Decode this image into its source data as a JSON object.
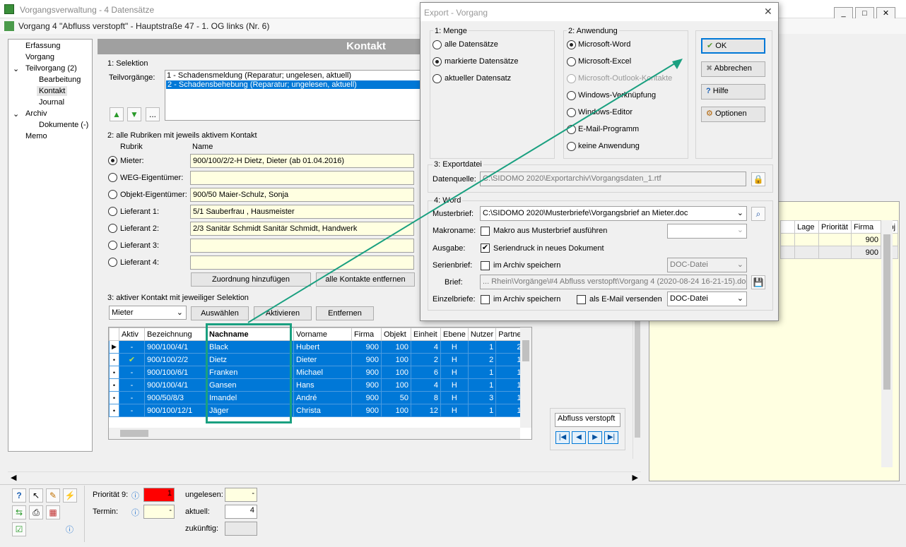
{
  "main_window": {
    "title": "Vorgangsverwaltung - 4 Datensätze",
    "subtitle": "Vorgang 4 \"Abfluss verstopft\" - Hauptstraße 47 - 1. OG links (Nr. 6)"
  },
  "tree": [
    "Erfassung",
    "Vorgang",
    "Teilvorgang (2)",
    "Bearbeitung",
    "Kontakt",
    "Journal",
    "Archiv",
    "Dokumente (-)",
    "Memo"
  ],
  "panel_title": "Kontakt",
  "selektion": {
    "legend": "1: Selektion",
    "label": "Teilvorgänge:",
    "items": [
      "1 - Schadensmeldung (Reparatur;  ungelesen, aktuell)",
      "2 - Schadensbehebung (Reparatur;  ungelesen, aktuell)"
    ],
    "more_label": "..."
  },
  "rubriken": {
    "legend": "2: alle Rubriken mit jeweils aktivem Kontakt",
    "col_rubrik": "Rubrik",
    "col_name": "Name",
    "rows": [
      {
        "label": "Mieter:",
        "value": "900/100/2/2-H  Dietz, Dieter  (ab 01.04.2016)"
      },
      {
        "label": "WEG-Eigentümer:",
        "value": ""
      },
      {
        "label": "Objekt-Eigentümer:",
        "value": "900/50  Maier-Schulz, Sonja"
      },
      {
        "label": "Lieferant 1:",
        "value": "5/1  Sauberfrau  , Hausmeister"
      },
      {
        "label": "Lieferant 2:",
        "value": "2/3  Sanitär Schmidt  Sanitär Schmidt, Handwerk"
      },
      {
        "label": "Lieferant 3:",
        "value": ""
      },
      {
        "label": "Lieferant 4:",
        "value": ""
      }
    ],
    "btn_add": "Zuordnung hinzufügen",
    "btn_remove_all": "alle Kontakte entfernen"
  },
  "aktiv": {
    "legend": "3: aktiver Kontakt mit jeweiliger Selektion",
    "dropdown": "Mieter",
    "btn_select": "Auswählen",
    "btn_activate": "Aktivieren",
    "btn_remove": "Entfernen",
    "columns": [
      "Aktiv",
      "Bezeichnung",
      "Nachname",
      "Vorname",
      "Firma",
      "Objekt",
      "Einheit",
      "Ebene",
      "Nutzer",
      "Partne"
    ],
    "rows": [
      [
        "-",
        "900/100/4/1",
        "Black",
        "Hubert",
        "900",
        "100",
        "4",
        "H",
        "1",
        "2"
      ],
      [
        "✔",
        "900/100/2/2",
        "Dietz",
        "Dieter",
        "900",
        "100",
        "2",
        "H",
        "2",
        "1"
      ],
      [
        "-",
        "900/100/6/1",
        "Franken",
        "Michael",
        "900",
        "100",
        "6",
        "H",
        "1",
        "1"
      ],
      [
        "-",
        "900/100/4/1",
        "Gansen",
        "Hans",
        "900",
        "100",
        "4",
        "H",
        "1",
        "1"
      ],
      [
        "-",
        "900/50/8/3",
        "Imandel",
        "André",
        "900",
        "50",
        "8",
        "H",
        "3",
        "1"
      ],
      [
        "-",
        "900/100/12/1",
        "Jäger",
        "Christa",
        "900",
        "100",
        "12",
        "H",
        "1",
        "1"
      ]
    ]
  },
  "nav": {
    "text": "Abfluss verstopft"
  },
  "right_grid": {
    "columns": [
      "Lage",
      "Priorität",
      "Firma",
      "Obj"
    ],
    "rows": [
      [
        "",
        "",
        "900",
        ""
      ],
      [
        "",
        "",
        "900",
        ""
      ]
    ]
  },
  "status": {
    "prio_label": "Priorität 9:",
    "prio_value": "1",
    "termin_label": "Termin:",
    "termin_value": "-",
    "ungelesen_label": "ungelesen:",
    "ungelesen_value": "-",
    "aktuell_label": "aktuell:",
    "aktuell_value": "4",
    "zukuenftig_label": "zukünftig:",
    "zukuenftig_value": ""
  },
  "dialog": {
    "title": "Export - Vorgang",
    "menge": {
      "legend": "1: Menge",
      "options": [
        "alle Datensätze",
        "markierte Datensätze",
        "aktueller Datensatz"
      ],
      "selected": 1
    },
    "anwendung": {
      "legend": "2: Anwendung",
      "options": [
        "Microsoft-Word",
        "Microsoft-Excel",
        "Microsoft-Outlook-Kontakte",
        "Windows-Verknüpfung",
        "Windows-Editor",
        "E-Mail-Programm",
        "keine Anwendung"
      ],
      "selected": 0,
      "disabled": 2
    },
    "buttons": {
      "ok": "OK",
      "cancel": "Abbrechen",
      "help": "Hilfe",
      "options": "Optionen"
    },
    "exportdatei": {
      "legend": "3: Exportdatei",
      "label": "Datenquelle:",
      "value": "C:\\SIDOMO 2020\\Exportarchiv\\Vorgangsdaten_1.rtf"
    },
    "word": {
      "legend": "4: Word",
      "musterbrief_label": "Musterbrief:",
      "musterbrief_value": "C:\\SIDOMO 2020\\Musterbriefe\\Vorgangsbrief an Mieter.doc",
      "makroname_label": "Makroname:",
      "makro_chk": "Makro aus Musterbrief ausführen",
      "ausgabe_label": "Ausgabe:",
      "ausgabe_chk": "Seriendruck in neues Dokument",
      "serienbrief_label": "Serienbrief:",
      "serienbrief_chk": "im Archiv speichern",
      "serienbrief_fmt": "DOC-Datei",
      "brief_label": "Brief:",
      "brief_value": "... Rhein\\Vorgänge\\#4 Abfluss verstopft\\Vorgang 4 (2020-08-24 16-21-15).doc",
      "einzelbriefe_label": "Einzelbriefe:",
      "einzel_chk": "im Archiv speichern",
      "email_chk": "als E-Mail versenden",
      "einzel_fmt": "DOC-Datei"
    }
  }
}
